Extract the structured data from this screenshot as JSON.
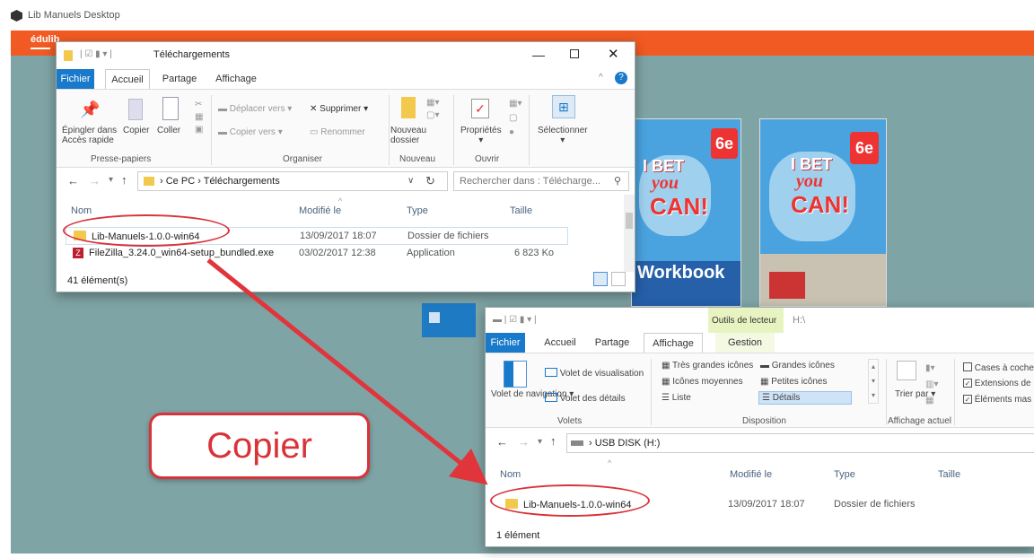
{
  "app": {
    "title": "Lib Manuels Desktop",
    "brand": "édulib"
  },
  "books": [
    {
      "line1": "I BET",
      "line2": "you",
      "line3": "CAN!",
      "grade": "6e",
      "footer": "Workbook"
    },
    {
      "line1": "I BET",
      "line2": "you",
      "line3": "CAN!",
      "grade": "6e",
      "footer": ""
    }
  ],
  "win1": {
    "title": "Téléchargements",
    "tabs": [
      "Fichier",
      "Accueil",
      "Partage",
      "Affichage"
    ],
    "ribbon": {
      "pin": "Épingler dans Accès rapide",
      "copy": "Copier",
      "paste": "Coller",
      "move_to": "Déplacer vers",
      "copy_to": "Copier vers",
      "delete": "Supprimer",
      "rename": "Renommer",
      "new_folder": "Nouveau dossier",
      "properties": "Propriétés",
      "select": "Sélectionner"
    },
    "groups": [
      "Presse-papiers",
      "Organiser",
      "Nouveau",
      "Ouvrir"
    ],
    "address": {
      "pc": "Ce PC",
      "folder": "Téléchargements"
    },
    "search_placeholder": "Rechercher dans : Télécharge...",
    "columns": [
      "Nom",
      "Modifié le",
      "Type",
      "Taille"
    ],
    "rows": [
      {
        "name": "Lib-Manuels-1.0.0-win64",
        "date": "13/09/2017 18:07",
        "type": "Dossier de fichiers",
        "size": ""
      },
      {
        "name": "FileZilla_3.24.0_win64-setup_bundled.exe",
        "date": "03/02/2017 12:38",
        "type": "Application",
        "size": "6 823 Ko"
      }
    ],
    "status": "41 élément(s)"
  },
  "win2": {
    "title": "H:\\",
    "context_tab": "Outils de lecteur",
    "tabs": [
      "Fichier",
      "Accueil",
      "Partage",
      "Affichage",
      "Gestion"
    ],
    "ribbon": {
      "nav_pane": "Volet de navigation",
      "preview_pane": "Volet de visualisation",
      "details_pane": "Volet des détails",
      "xl_icons": "Très grandes icônes",
      "lg_icons": "Grandes icônes",
      "md_icons": "Icônes moyennes",
      "sm_icons": "Petites icônes",
      "list": "Liste",
      "details": "Détails",
      "sort": "Trier par",
      "checkboxes": "Cases à coche",
      "extensions": "Extensions de",
      "hidden": "Éléments mas"
    },
    "groups": [
      "Volets",
      "Disposition",
      "Affichage actuel"
    ],
    "address": {
      "drive": "USB DISK (H:)"
    },
    "columns": [
      "Nom",
      "Modifié le",
      "Type",
      "Taille"
    ],
    "rows": [
      {
        "name": "Lib-Manuels-1.0.0-win64",
        "date": "13/09/2017 18:07",
        "type": "Dossier de fichiers"
      }
    ],
    "status": "1 élément"
  },
  "callout": "Copier",
  "colors": {
    "accent": "#f15a22",
    "teal": "#7fa4a5",
    "file_tab": "#1979ca",
    "annotation": "#d9333a"
  }
}
